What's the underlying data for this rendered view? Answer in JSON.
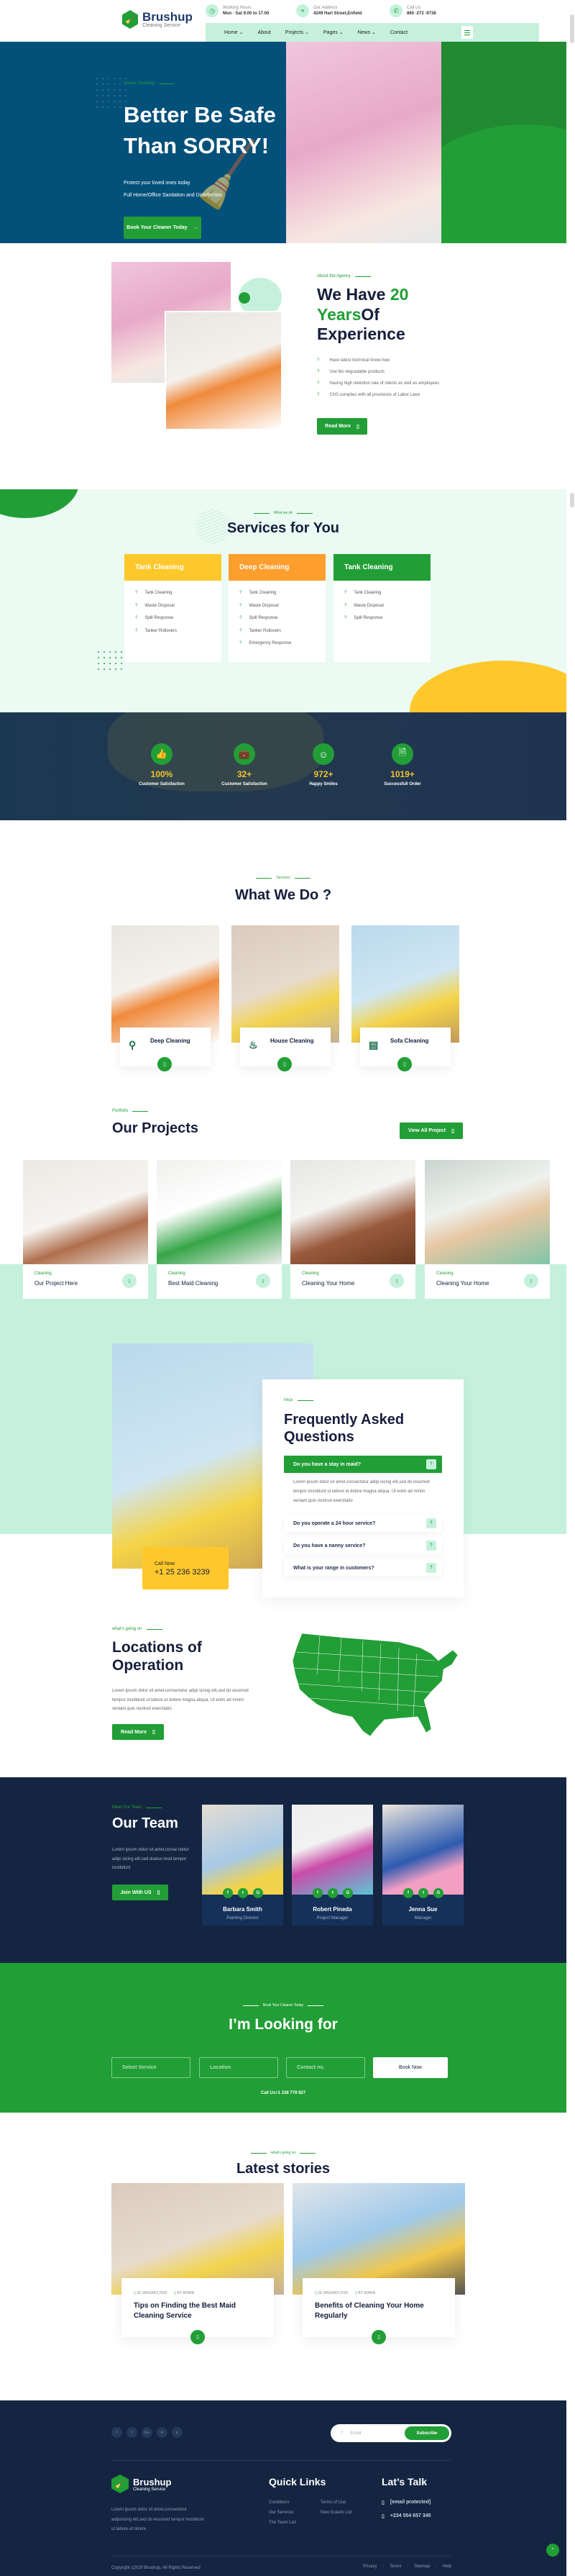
{
  "header": {
    "brand": {
      "name": "Brushup",
      "tagline": "Cleaning Service"
    },
    "info": [
      {
        "icon": "clock-icon",
        "label": "Working Hours",
        "value": "Mon - Sat 9.00 to 17.00"
      },
      {
        "icon": "map-pin-icon",
        "label": "Our Address",
        "value": "4249 Hart Street,Enfield"
      },
      {
        "icon": "phone-icon",
        "label": "Call Us",
        "value": "860 -272 -9738"
      }
    ],
    "nav": [
      "Home ⌄",
      "About",
      "Projects ⌄",
      "Pages ⌄",
      "News ⌄",
      "Contact"
    ]
  },
  "hero": {
    "eyebrow": "House Cleaning",
    "title_line1": "Better Be Safe",
    "title_line2": "Than SORRY!",
    "desc_line1": "Protect your loved ones today",
    "desc_line2": "Full Home/Office Sanitation and Disinfection.",
    "cta": "Book Your Cleaner Today",
    "cta_icon": "→"
  },
  "about": {
    "eyebrow": "About the Agency",
    "title_a": "We Have ",
    "title_b": "20",
    "title_c": "Years",
    "title_d": "Of",
    "title_e": "Experience",
    "bullets": [
      "Have latest technical know-how",
      "Use bio degradable products",
      "Having high retention rate of clients as well as employees",
      "CHS complies with all provisions of Labor Laws"
    ],
    "bullet_icon": "?",
    "cta": "Read More",
    "cta_icon": "▯"
  },
  "services": {
    "eyebrow": "What we do",
    "title": "Services for You",
    "cards": [
      {
        "title": "Tank Cleaning",
        "color": "#fec82c",
        "items": [
          "Tank Cleaning",
          "Waste Disposal",
          "Spill Response",
          "Tanker Rollovers"
        ]
      },
      {
        "title": "Deep Cleaning",
        "color": "#fd9e2d",
        "items": [
          "Tank Cleaning",
          "Waste Disposal",
          "Spill Response",
          "Tanker Rollovers",
          "Emergency Response"
        ]
      },
      {
        "title": "Tank Cleaning",
        "color": "#229e36",
        "items": [
          "Tank Cleaning",
          "Waste Disposal",
          "Spill Response"
        ]
      }
    ]
  },
  "stats": [
    {
      "icon": "👍",
      "value": "100%",
      "label": "Customer Satisfaction"
    },
    {
      "icon": "💼",
      "value": "32+",
      "label": "Customer Satisfaction"
    },
    {
      "icon": "☺",
      "value": "972+",
      "label": "Happy Smiles"
    },
    {
      "icon": "🗎",
      "value": "1019+",
      "label": "Successfull Order"
    }
  ],
  "what_we_do": {
    "eyebrow": "Services",
    "title": "What We Do ?",
    "cards": [
      {
        "title": "Deep Cleaning",
        "icon": "⚲"
      },
      {
        "title": "House Cleaning",
        "icon": "♨"
      },
      {
        "title": "Sofa Cleaning",
        "icon": "▤"
      }
    ],
    "btn_icon": "▯"
  },
  "projects": {
    "eyebrow": "Portfolio",
    "title": "Our Projects",
    "cta": "View All Project",
    "cta_icon": "▯",
    "items": [
      {
        "category": "Cleaning",
        "title": "Our Project Here"
      },
      {
        "category": "Cleaning",
        "title": "Best Maid Cleaning"
      },
      {
        "category": "Cleaning",
        "title": "Cleaning Your Home"
      },
      {
        "category": "Cleaning",
        "title": "Cleaning Your Home"
      }
    ],
    "arrow_icon": "▯"
  },
  "faq": {
    "call_label": "Call Now",
    "call_number": "+1 25 236 3239",
    "eyebrow": "FAQs",
    "title_line1": "Frequently Asked",
    "title_line2": "Questions",
    "questions": [
      {
        "q": "Do you have a stay in maid?",
        "open": true,
        "answer": "Lorem ipsum dolor sit amet,consectetur adipi sicing elit,sed do eiusmod tempor incididunt ut labore et dolore magna aliqua. Ut enim ad minim veniam,quis nostrud exercitatio"
      },
      {
        "q": "Do you operate a 24 hour service?",
        "open": false
      },
      {
        "q": "Do you have a nanny service?",
        "open": false
      },
      {
        "q": "What is your range in customers?",
        "open": false
      }
    ],
    "toggle_icon": "?"
  },
  "locations": {
    "eyebrow": "what's going on",
    "title_line1": "Locations of",
    "title_line2": "Operation",
    "desc": "Lorem ipsum dolor sit amet,consectetur adipi sicing elit,sed do eiusmod tempor incididunt ut labore et dolore magna aliqua. Ut enim ad minim veniam,quis nostrud exercitatio",
    "cta": "Read More",
    "cta_icon": "▯"
  },
  "team": {
    "eyebrow": "Meet Our Team",
    "title": "Our Team",
    "desc": "Lorem ipsum dolor sit amet,conse ctetur adipi sicing elit,sed doeius mod tempor incididunt",
    "cta": "Join With US",
    "cta_icon": "▯",
    "members": [
      {
        "name": "Barbara Smith",
        "role": "Painting Director"
      },
      {
        "name": "Robert Pineda",
        "role": "Project Manager"
      },
      {
        "name": "Jenna Sue",
        "role": "Manager"
      }
    ],
    "social": [
      "f",
      "t",
      "G"
    ]
  },
  "booking": {
    "eyebrow": "Book Your Cleaner Today",
    "title": "I’m Looking for",
    "fields": [
      "Select Service",
      "Location",
      "Contact no."
    ],
    "cta": "Book Now",
    "call": "Call Us+1 228 778 927"
  },
  "stories": {
    "eyebrow": "what's going on",
    "title": "Latest stories",
    "posts": [
      {
        "date": "28 JANUARY,2020",
        "author": "BY ADMIN",
        "title": "Tips on Finding the Best Maid Cleaning Service"
      },
      {
        "date": "28 JANUARY,2020",
        "author": "BY ADMIN",
        "title": "Benefits of Cleaning Your Home Regularly"
      }
    ],
    "meta_icon": "▯",
    "btn_icon": "▯"
  },
  "footer": {
    "social": [
      "f",
      "t",
      "G+",
      "in",
      "p"
    ],
    "email_icon": "?",
    "email_placeholder": "Email",
    "subscribe": "Subscribe",
    "brand": {
      "name": "Brushup",
      "tagline": "Cleaning Service"
    },
    "about": "Lorem ipsum dolor sit amet,consectetur adipisicing elit,sed do eiusmod tempor incididunt ut labore et dolore",
    "quick_links_title": "Quick Links",
    "links_col1": [
      "Conditions",
      "Our Services",
      "The Team List"
    ],
    "links_col2": [
      "Terms of Use",
      "New Guests List"
    ],
    "talk_title": "Lat’s Talk",
    "email": "[email protected]",
    "phone": "+234 554 657 345",
    "contact_icon": "▯",
    "copyright": "Copyright ▯2020 Brushup. All Rights Reserved",
    "bottom_links": [
      "Privacy",
      "Terms",
      "Sitemap",
      "Help"
    ]
  },
  "colors": {
    "primary": "#229e36",
    "navy": "#142541",
    "mint": "#c5f1dc",
    "hero_blue": "#03507a",
    "yellow": "#fec82c",
    "orange": "#fd9e2d"
  }
}
